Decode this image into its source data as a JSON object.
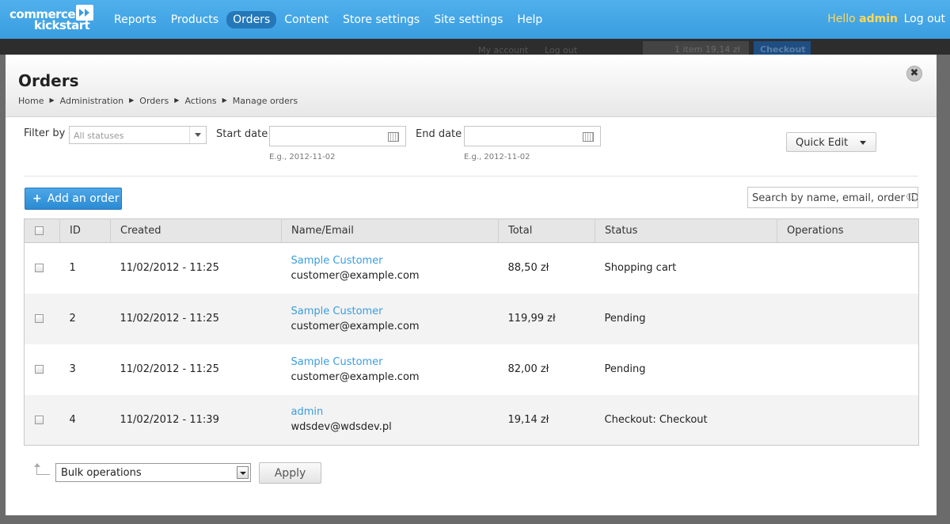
{
  "topbar": {
    "logo": {
      "line1": "commerce",
      "line2": "kickstart"
    },
    "nav": [
      {
        "label": "Reports"
      },
      {
        "label": "Products"
      },
      {
        "label": "Orders",
        "active": true
      },
      {
        "label": "Content"
      },
      {
        "label": "Store settings"
      },
      {
        "label": "Site settings"
      },
      {
        "label": "Help"
      }
    ],
    "greeting": "Hello",
    "username": "admin",
    "logout": "Log out"
  },
  "background_page": {
    "my_account": "My account",
    "log_out": "Log out",
    "cart": "1 item  19,14 zł",
    "checkout": "Checkout"
  },
  "modal": {
    "title": "Orders",
    "breadcrumbs": [
      "Home",
      "Administration",
      "Orders",
      "Actions",
      "Manage orders"
    ],
    "close_icon": "close-icon"
  },
  "filters": {
    "filter_by_label": "Filter by",
    "status_placeholder": "All statuses",
    "start_date_label": "Start date",
    "start_date_value": "",
    "start_date_hint": "E.g., 2012-11-02",
    "end_date_label": "End date",
    "end_date_value": "",
    "end_date_hint": "E.g., 2012-11-02",
    "quick_edit": "Quick Edit"
  },
  "actions": {
    "add_order": "Add an order",
    "search_placeholder": "Search by name, email, order ID"
  },
  "table": {
    "columns": [
      "ID",
      "Created",
      "Name/Email",
      "Total",
      "Status",
      "Operations"
    ],
    "rows": [
      {
        "id": "1",
        "created": "11/02/2012 - 11:25",
        "name": "Sample Customer",
        "email": "customer@example.com",
        "total": "88,50 zł",
        "status": "Shopping cart",
        "operations": ""
      },
      {
        "id": "2",
        "created": "11/02/2012 - 11:25",
        "name": "Sample Customer",
        "email": "customer@example.com",
        "total": "119,99 zł",
        "status": "Pending",
        "operations": ""
      },
      {
        "id": "3",
        "created": "11/02/2012 - 11:25",
        "name": "Sample Customer",
        "email": "customer@example.com",
        "total": "82,00 zł",
        "status": "Pending",
        "operations": ""
      },
      {
        "id": "4",
        "created": "11/02/2012 - 11:39",
        "name": "admin",
        "email": "wdsdev@wdsdev.pl",
        "total": "19,14 zł",
        "status": "Checkout: Checkout",
        "operations": ""
      }
    ]
  },
  "bulk": {
    "select_value": "Bulk operations",
    "apply": "Apply"
  },
  "colors": {
    "topbar": "#3a9ddf",
    "link": "#3a9ddf",
    "greeting": "#ffd85a",
    "primary_button": "#2a8bd3"
  }
}
